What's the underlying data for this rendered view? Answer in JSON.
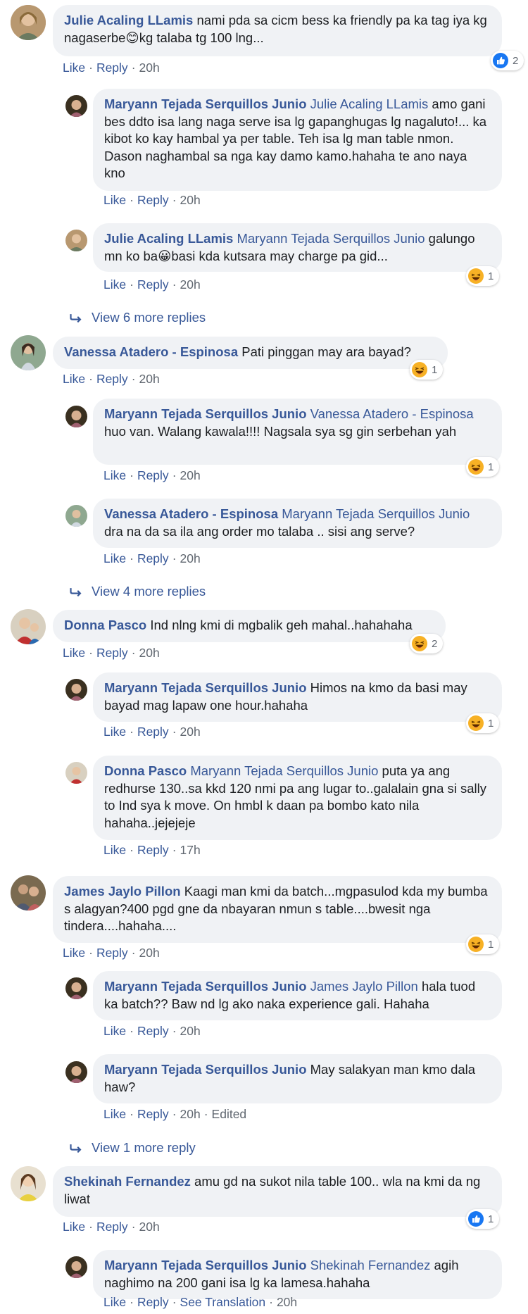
{
  "labels": {
    "like": "Like",
    "reply": "Reply",
    "see_translation": "See Translation",
    "edited": "Edited"
  },
  "reaction_types": {
    "like": "like-icon",
    "haha": "haha-icon"
  },
  "colors": {
    "link": "#385898",
    "bubble": "#f0f2f5",
    "meta": "#606770",
    "like_blue": "#1877f2",
    "haha_yellow": "#f7b125"
  },
  "threads": [
    {
      "comment": {
        "author": "Julie Acaling LLamis",
        "text": "nami pda sa cicm bess ka friendly pa ka tag iya kg nagaserbe😊kg talaba tg 100 lng...",
        "time": "20h",
        "reaction_count": "2"
      },
      "replies": [
        {
          "author": "Maryann Tejada Serquillos Junio",
          "mention": "Julie Acaling LLamis",
          "text": "amo gani bes ddto isa lang naga serve isa lg gapanghugas lg nagaluto!... ka kibot ko kay hambal ya per table. Teh isa lg man table nmon. Dason naghambal sa nga kay damo kamo.hahaha te ano naya kno",
          "time": "20h"
        },
        {
          "author": "Julie Acaling LLamis",
          "mention": "Maryann Tejada Serquillos Junio",
          "text": "galungo mn ko ba😀basi kda kutsara may charge pa gid...",
          "time": "20h",
          "reaction_count": "1"
        }
      ],
      "view_more": "View 6 more replies"
    },
    {
      "comment": {
        "author": "Vanessa Atadero - Espinosa",
        "text": "Pati pinggan may ara bayad?",
        "time": "20h",
        "reaction_count": "1"
      },
      "replies": [
        {
          "author": "Maryann Tejada Serquillos Junio",
          "mention": "Vanessa Atadero - Espinosa",
          "text": "huo van. Walang kawala!!!! Nagsala sya sg gin serbehan yah",
          "time": "20h",
          "reaction_count": "1"
        },
        {
          "author": "Vanessa Atadero - Espinosa",
          "mention": "Maryann Tejada Serquillos Junio",
          "text": "dra na da sa ila ang order mo talaba .. sisi ang serve?",
          "time": "20h"
        }
      ],
      "view_more": "View 4 more replies"
    },
    {
      "comment": {
        "author": "Donna Pasco",
        "text": "Ind nlng kmi di mgbalik geh mahal..hahahaha",
        "time": "20h",
        "reaction_count": "2"
      },
      "replies": [
        {
          "author": "Maryann Tejada Serquillos Junio",
          "text": "Himos na kmo da basi may bayad mag lapaw one hour.hahaha",
          "time": "20h",
          "reaction_count": "1"
        },
        {
          "author": "Donna Pasco",
          "mention": "Maryann Tejada Serquillos Junio",
          "text": "puta ya ang redhurse 130..sa kkd 120 nmi pa ang lugar to..galalain gna si sally to Ind sya k move. On hmbl k daan pa bombo kato nila hahaha..jejejeje",
          "time": "17h"
        }
      ]
    },
    {
      "comment": {
        "author": "James Jaylo Pillon",
        "text": "Kaagi man kmi da batch...mgpasulod kda my bumba s alagyan?400 pgd gne da nbayaran nmun s table....bwesit nga tindera....hahaha....",
        "time": "20h",
        "reaction_count": "1"
      },
      "replies": [
        {
          "author": "Maryann Tejada Serquillos Junio",
          "mention": "James Jaylo Pillon",
          "text": "hala tuod ka batch?? Baw nd lg ako naka experience gali. Hahaha",
          "time": "20h"
        },
        {
          "author": "Maryann Tejada Serquillos Junio",
          "text": "May salakyan man kmo dala haw?",
          "time": "20h"
        }
      ],
      "view_more": "View 1 more reply"
    },
    {
      "comment": {
        "author": "Shekinah Fernandez",
        "text": "amu gd na sukot nila table 100.. wla na kmi da ng liwat",
        "time": "20h",
        "reaction_count": "1"
      },
      "replies": [
        {
          "author": "Maryann Tejada Serquillos Junio",
          "mention": "Shekinah Fernandez",
          "text": "agih naghimo na 200 gani isa lg ka lamesa.hahaha",
          "time": "20h"
        }
      ]
    }
  ]
}
